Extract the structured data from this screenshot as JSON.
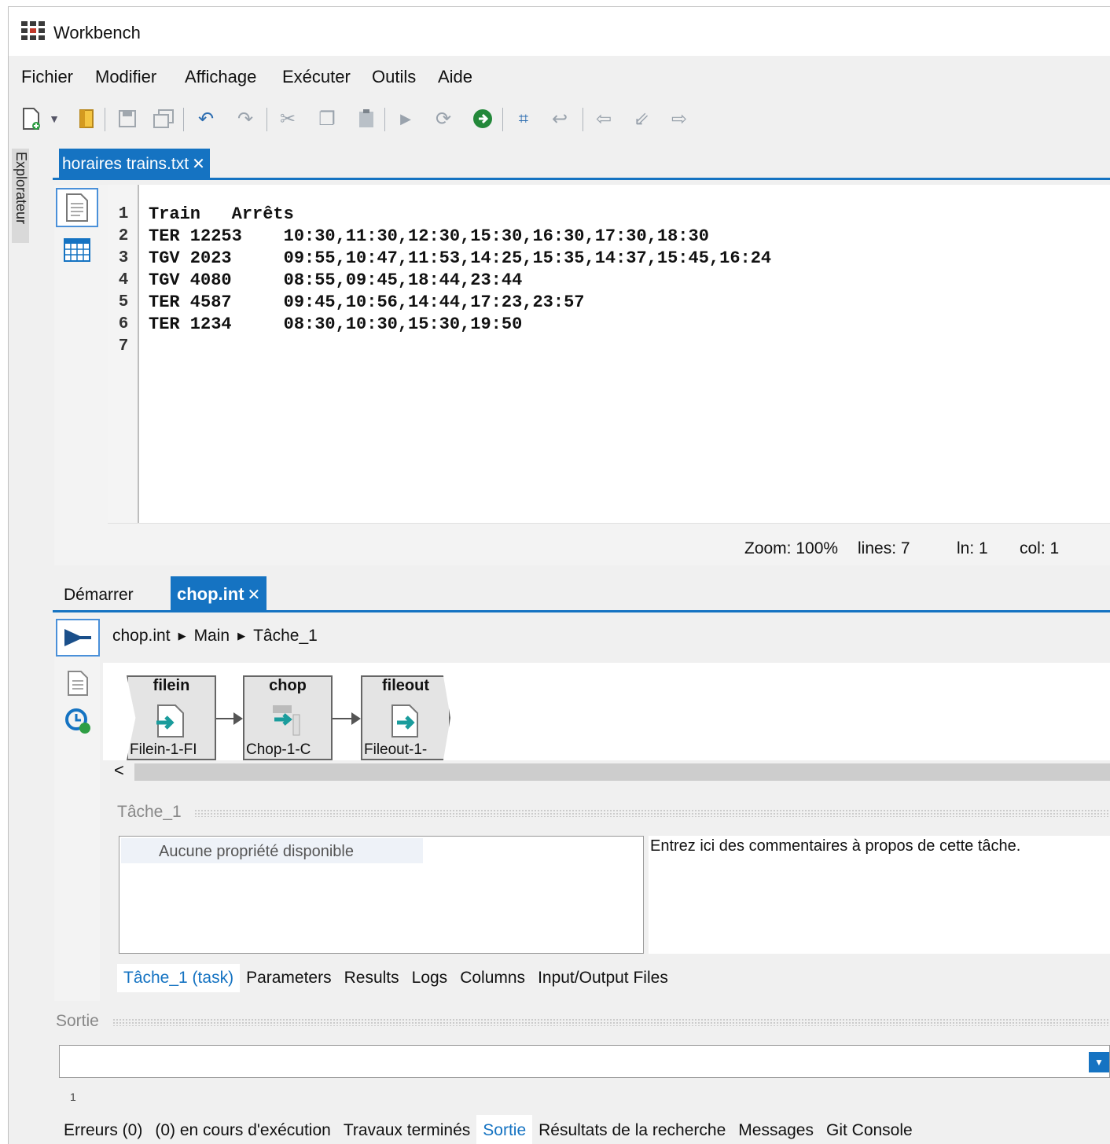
{
  "window": {
    "title": "Workbench"
  },
  "menu": [
    "Fichier",
    "Modifier",
    "Affichage",
    "Exécuter",
    "Outils",
    "Aide"
  ],
  "sidebar": {
    "explorer_label": "Explorateur"
  },
  "editor": {
    "tab_label": "horaires trains.txt",
    "line_numbers": [
      "1",
      "2",
      "3",
      "4",
      "5",
      "6",
      "7"
    ],
    "lines": [
      "Train   Arrêts",
      "TER 12253    10:30,11:30,12:30,15:30,16:30,17:30,18:30",
      "TGV 2023     09:55,10:47,11:53,14:25,15:35,14:37,15:45,16:24",
      "TGV 4080     08:55,09:45,18:44,23:44",
      "TER 4587     09:45,10:56,14:44,17:23,23:57",
      "TER 1234     08:30,10:30,15:30,19:50",
      ""
    ],
    "status": {
      "zoom": "Zoom: 100%",
      "lines": "lines: 7",
      "ln": "ln: 1",
      "col": "col: 1"
    }
  },
  "lower": {
    "tabs": {
      "start": "Démarrer",
      "active": "chop.int"
    },
    "breadcrumb": [
      "chop.int",
      "Main",
      "Tâche_1"
    ],
    "nodes": [
      {
        "title": "filein",
        "label": "Filein-1-FI"
      },
      {
        "title": "chop",
        "label": "Chop-1-C"
      },
      {
        "title": "fileout",
        "label": "Fileout-1-"
      }
    ],
    "scroll_left": "<",
    "section_title": "Tâche_1",
    "properties_empty": "Aucune propriété disponible",
    "comment_placeholder": "Entrez ici des commentaires à propos de cette tâche.",
    "sub_tabs": [
      "Tâche_1 (task)",
      "Parameters",
      "Results",
      "Logs",
      "Columns",
      "Input/Output Files"
    ]
  },
  "output": {
    "section_title": "Sortie",
    "combo_value": "",
    "first_line": "1"
  },
  "bottom_tabs": [
    "Erreurs (0)",
    "(0) en cours d'exécution",
    "Travaux terminés",
    "Sortie",
    "Résultats de la recherche",
    "Messages",
    "Git Console"
  ],
  "colors": {
    "accent": "#1573c2"
  }
}
